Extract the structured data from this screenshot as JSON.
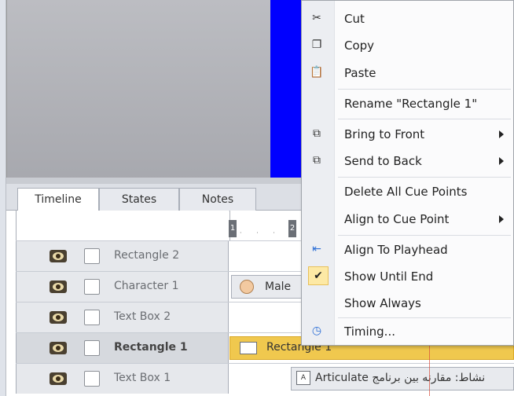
{
  "tabs": [
    {
      "label": "Timeline",
      "active": true
    },
    {
      "label": "States",
      "active": false
    },
    {
      "label": "Notes",
      "active": false
    }
  ],
  "ruler": {
    "markers": [
      "1",
      "2"
    ]
  },
  "rows": [
    {
      "name": "Rectangle 2",
      "selected": false,
      "bar": null
    },
    {
      "name": "Character 1",
      "selected": false,
      "bar": "Male"
    },
    {
      "name": "Text Box 2",
      "selected": false,
      "bar": null
    },
    {
      "name": "Rectangle 1",
      "selected": true,
      "bar": "Rectangle 1"
    },
    {
      "name": "Text Box 1",
      "selected": false,
      "bar": "Articulate نشاط: مقارنه بین برنامج"
    }
  ],
  "menu": {
    "cut": "Cut",
    "copy": "Copy",
    "paste": "Paste",
    "rename": "Rename \"Rectangle 1\"",
    "bring_to_front": "Bring to Front",
    "send_to_back": "Send to Back",
    "delete_cue_points": "Delete All Cue Points",
    "align_cue_point": "Align to Cue Point",
    "align_playhead": "Align To Playhead",
    "show_until_end": "Show Until End",
    "show_always": "Show Always",
    "timing": "Timing..."
  },
  "colors": {
    "slide_blue": "#0000ff",
    "selected_bar": "#f0c84e",
    "playhead": "#d94b3b",
    "checked_highlight": "#fde9a5"
  },
  "icons": {
    "cut": "scissors-icon",
    "copy": "copy-icon",
    "paste": "paste-icon",
    "bring_to_front": "bring-to-front-icon",
    "send_to_back": "send-to-back-icon",
    "align_playhead": "align-left-arrow-icon",
    "show_until_end": "checkmark-icon",
    "timing": "clock-icon"
  }
}
